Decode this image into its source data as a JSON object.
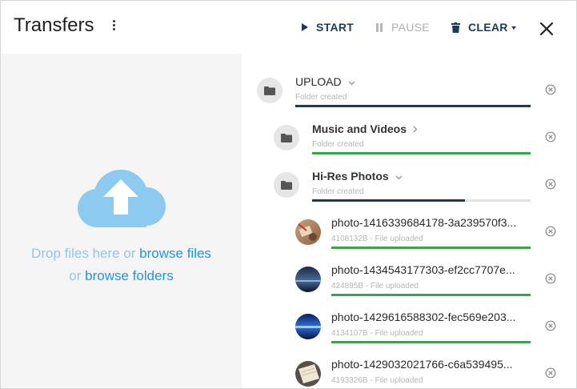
{
  "header": {
    "title": "Transfers",
    "start_label": "START",
    "pause_label": "PAUSE",
    "clear_label": "CLEAR"
  },
  "dropzone": {
    "prefix1": "Drop files here or ",
    "link_files": "browse files",
    "prefix2": "or ",
    "link_folders": "browse folders"
  },
  "transfers": [
    {
      "name": "UPLOAD",
      "status": "Folder created",
      "type": "folder",
      "expand": "expanded",
      "progress": 1.0,
      "bar_color": "navy"
    },
    {
      "name": "Music and Videos",
      "status": "Folder created",
      "type": "folder",
      "expand": "collapsed",
      "progress": 1.0,
      "bar_color": "green"
    },
    {
      "name": "Hi-Res Photos",
      "status": "Folder created",
      "type": "folder",
      "expand": "expanded",
      "progress": 0.7,
      "bar_color": "navy"
    },
    {
      "name": "photo-1416339684178-3a239570f3...",
      "status": "4108132B - File uploaded",
      "type": "photo",
      "thumb": "warm",
      "progress": 1.0,
      "bar_color": "green"
    },
    {
      "name": "photo-1434543177303-ef2cc7707e...",
      "status": "424895B - File uploaded",
      "type": "photo",
      "thumb": "night",
      "progress": 1.0,
      "bar_color": "green"
    },
    {
      "name": "photo-1429616588302-fec569e203...",
      "status": "4134107B - File uploaded",
      "type": "photo",
      "thumb": "blue",
      "progress": 1.0,
      "bar_color": "green"
    },
    {
      "name": "photo-1429032021766-c6a539495...",
      "status": "4193326B - File uploaded",
      "type": "photo",
      "thumb": "paper",
      "progress": 1.0,
      "bar_color": "green"
    }
  ],
  "colors": {
    "navy": "#1b3a56",
    "green": "#3ca34b",
    "link": "#1c97e0",
    "cloud": "#8ccaf0"
  }
}
